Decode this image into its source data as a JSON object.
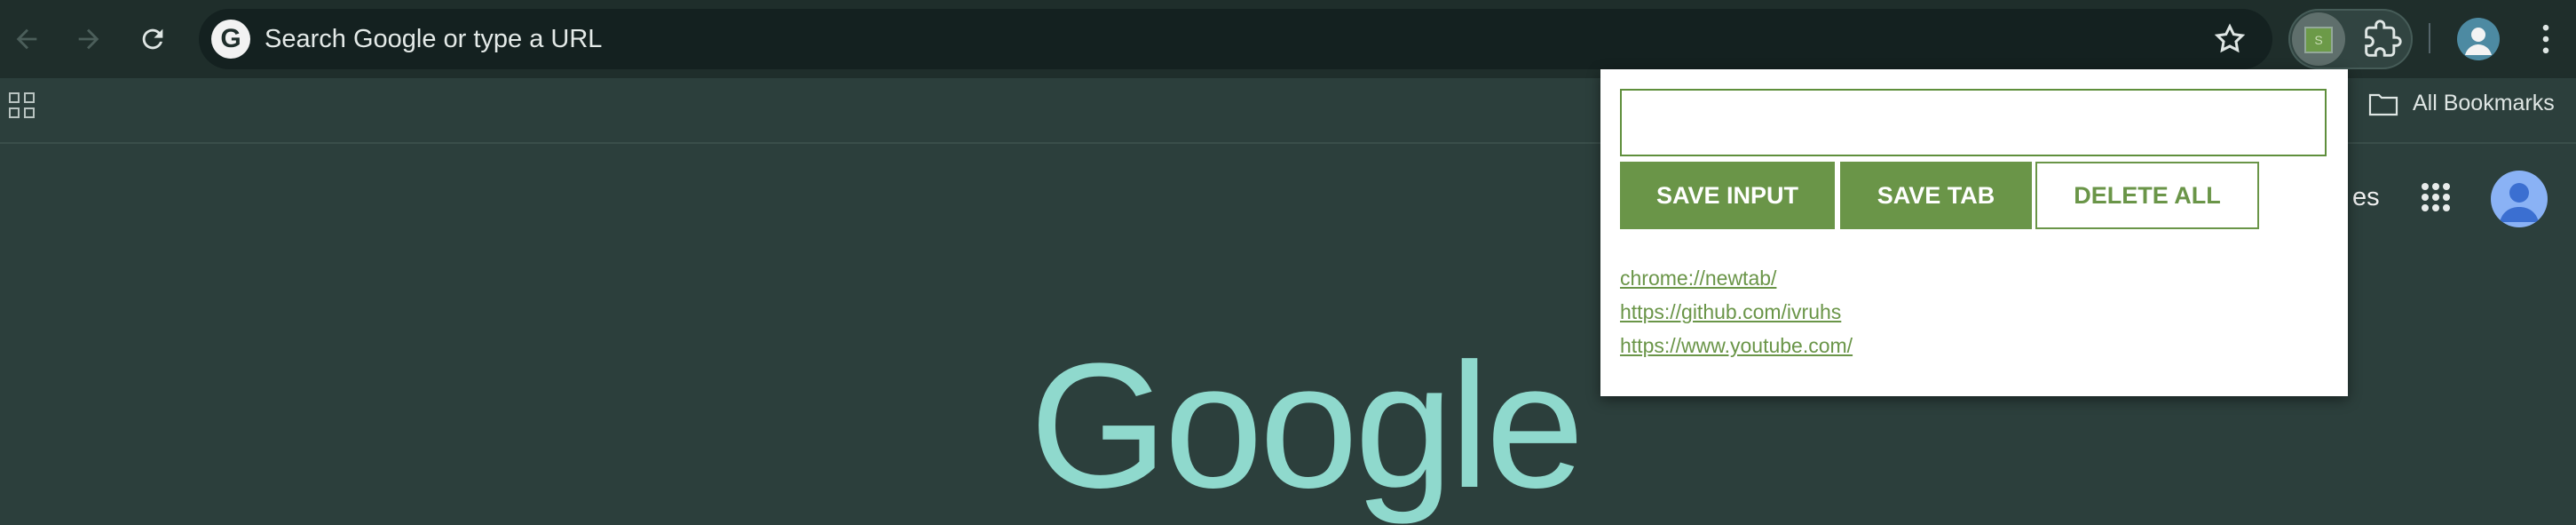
{
  "omnibox": {
    "placeholder": "Search Google or type a URL",
    "logo_letter": "G"
  },
  "extension_icon_letter": "S",
  "bookmarks_bar": {
    "all_bookmarks_label": "All Bookmarks"
  },
  "ntp": {
    "partial_text": "es",
    "logo_text": "Google"
  },
  "popup": {
    "input_value": "",
    "buttons": {
      "save_input": "SAVE INPUT",
      "save_tab": "SAVE TAB",
      "delete_all": "DELETE ALL"
    },
    "links": [
      "chrome://newtab/",
      "https://github.com/ivruhs",
      "https://www.youtube.com/"
    ]
  },
  "colors": {
    "toolbar_bg": "#1f2e2b",
    "page_bg": "#2c3f3c",
    "accent_green": "#6a9548",
    "google_logo": "#8fd9cd"
  }
}
